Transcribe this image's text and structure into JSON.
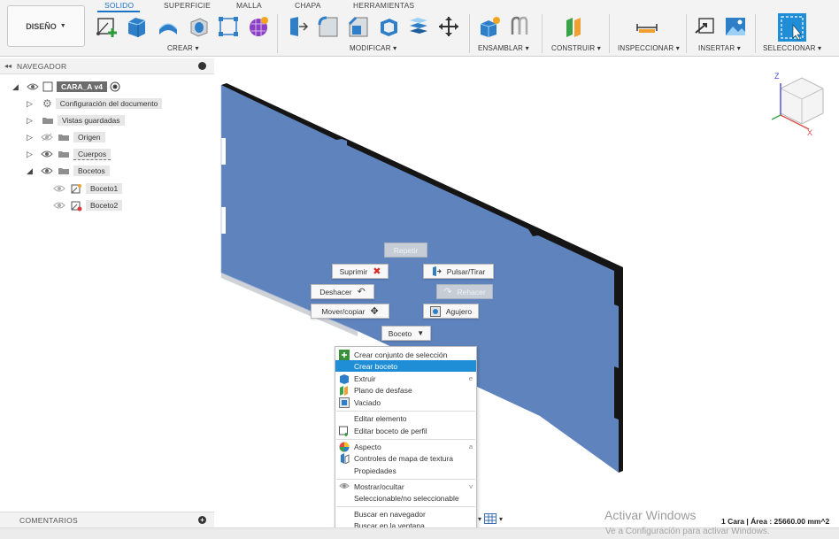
{
  "toolbar": {
    "workspace_label": "DISEÑO",
    "tabs": [
      "SOLIDO",
      "SUPERFICIE",
      "MALLA",
      "CHAPA",
      "HERRAMIENTAS"
    ],
    "groups": [
      "CREAR",
      "MODIFICAR",
      "ENSAMBLAR",
      "CONSTRUIR",
      "INSPECCIONAR",
      "INSERTAR",
      "SELECCIONAR"
    ]
  },
  "browser": {
    "title": "NAVEGADOR",
    "items": [
      {
        "label": "CARA_A v4"
      },
      {
        "label": "Configuración del documento"
      },
      {
        "label": "Vistas guardadas"
      },
      {
        "label": "Origen"
      },
      {
        "label": "Cuerpos"
      },
      {
        "label": "Bocetos"
      },
      {
        "label": "Boceto1"
      },
      {
        "label": "Boceto2"
      }
    ]
  },
  "comments": {
    "title": "COMENTARIOS"
  },
  "marking_menu": {
    "repeat": "Repetir",
    "delete": "Suprimir",
    "press_pull": "Pulsar/Tirar",
    "undo": "Deshacer",
    "redo": "Rehacer",
    "move_copy": "Mover/copiar",
    "hole": "Agujero",
    "sketch": "Boceto"
  },
  "context_menu": {
    "items": [
      {
        "label": "Crear conjunto de selección",
        "key": ""
      },
      {
        "label": "Crear boceto",
        "key": ""
      },
      {
        "label": "Extruir",
        "key": "e"
      },
      {
        "label": "Plano de desfase",
        "key": ""
      },
      {
        "label": "Vaciado",
        "key": ""
      },
      {
        "label": "Editar elemento",
        "key": ""
      },
      {
        "label": "Editar boceto de perfil",
        "key": ""
      },
      {
        "label": "Aspecto",
        "key": "a"
      },
      {
        "label": "Controles de mapa de textura",
        "key": ""
      },
      {
        "label": "Propiedades",
        "key": ""
      },
      {
        "label": "Mostrar/ocultar",
        "key": "v"
      },
      {
        "label": "Seleccionable/no seleccionable",
        "key": ""
      },
      {
        "label": "Buscar en navegador",
        "key": ""
      },
      {
        "label": "Buscar en la ventana",
        "key": ""
      }
    ]
  },
  "viewcube": {
    "z": "Z",
    "x": "X"
  },
  "status": "1 Cara | Área : 25660.00 mm^2",
  "watermark": {
    "line1": "Activar Windows",
    "line2": "Ve a Configuración para activar Windows."
  },
  "colors": {
    "accent": "#1a73c4",
    "highlight": "#1f8ed6",
    "body_face": "#5f83bd",
    "body_edge": "#151515"
  }
}
